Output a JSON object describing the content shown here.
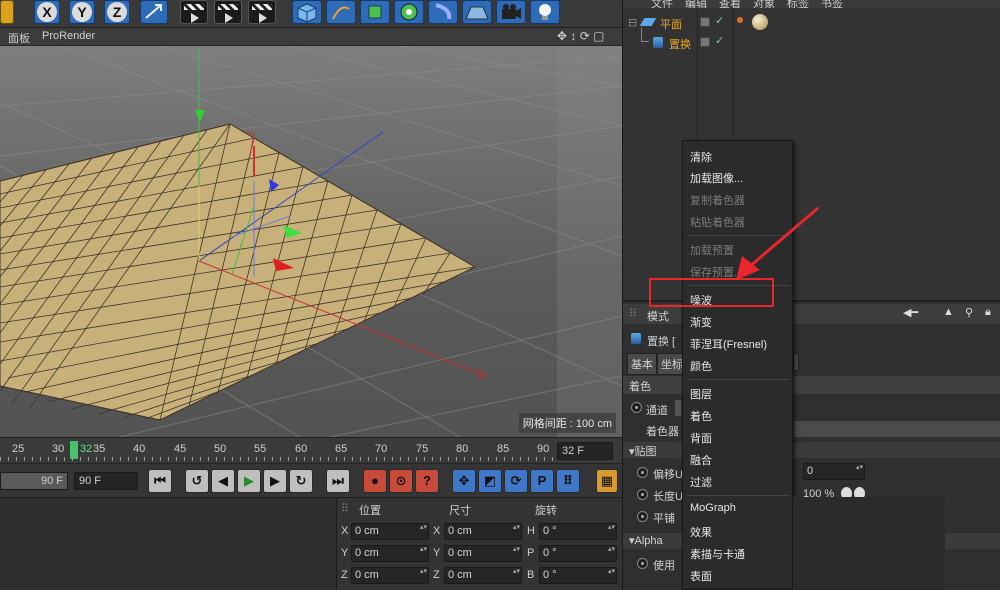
{
  "toolbar": {
    "xyz": [
      "X",
      "Y",
      "Z"
    ]
  },
  "viewport": {
    "menu": [
      "面板",
      "ProRender"
    ],
    "grid_label": "网格间距 : 100 cm"
  },
  "timeline": {
    "ticks": [
      "25",
      "30",
      "32",
      "35",
      "40",
      "45",
      "50",
      "55",
      "60",
      "65",
      "70",
      "75",
      "80",
      "85",
      "90"
    ],
    "current": "32 F",
    "field_a": "90 F",
    "field_b": "90 F"
  },
  "coords": {
    "headers": [
      "位置",
      "尺寸",
      "旋转"
    ],
    "rows": [
      {
        "a": "X",
        "a_val": "0 cm",
        "b": "X",
        "b_val": "0 cm",
        "c": "H",
        "c_val": "0 °"
      },
      {
        "a": "Y",
        "a_val": "0 cm",
        "b": "Y",
        "b_val": "0 cm",
        "c": "P",
        "c_val": "0 °"
      },
      {
        "a": "Z",
        "a_val": "0 cm",
        "b": "Z",
        "b_val": "0 cm",
        "c": "B",
        "c_val": "0 °"
      }
    ]
  },
  "objects": {
    "menubar": [
      "文件",
      "编辑",
      "查看",
      "对象",
      "标签",
      "书签"
    ],
    "items": [
      {
        "name": "平面"
      },
      {
        "name": "置换"
      }
    ]
  },
  "attributes": {
    "mode_label": "模式",
    "object_name": "置换 [",
    "tabs": [
      "基本",
      "坐标"
    ],
    "section": "着色",
    "channel_label": "通道",
    "shader_label": "着色器",
    "sub_section": "贴图",
    "offset_label": "偏移U",
    "offset_val": "0",
    "length_label": "长度U",
    "length_val": "100 %",
    "tile_label": "平铺",
    "alpha_section": "Alpha",
    "use_label": "使用"
  },
  "context_menu": {
    "items": [
      {
        "label": "清除",
        "enabled": true
      },
      {
        "label": "加载图像...",
        "enabled": true
      },
      {
        "label": "复制着色器",
        "enabled": false
      },
      {
        "label": "粘贴着色器",
        "enabled": false
      },
      {
        "label": "加载预置",
        "enabled": false
      },
      {
        "label": "保存预置...",
        "enabled": false
      },
      {
        "label": "噪波",
        "enabled": true
      },
      {
        "label": "渐变",
        "enabled": true
      },
      {
        "label": "菲涅耳(Fresnel)",
        "enabled": true
      },
      {
        "label": "颜色",
        "enabled": true
      },
      {
        "label": "图层",
        "enabled": true
      },
      {
        "label": "着色",
        "enabled": true
      },
      {
        "label": "背面",
        "enabled": true
      },
      {
        "label": "融合",
        "enabled": true
      },
      {
        "label": "过滤",
        "enabled": true
      },
      {
        "label": "MoGraph",
        "enabled": true
      },
      {
        "label": "效果",
        "enabled": true
      },
      {
        "label": "素描与卡通",
        "enabled": true
      },
      {
        "label": "表面",
        "enabled": true
      }
    ]
  },
  "colors": {
    "highlight": "#e8262b",
    "plane": "#c8b07a",
    "panel": "#333333"
  }
}
